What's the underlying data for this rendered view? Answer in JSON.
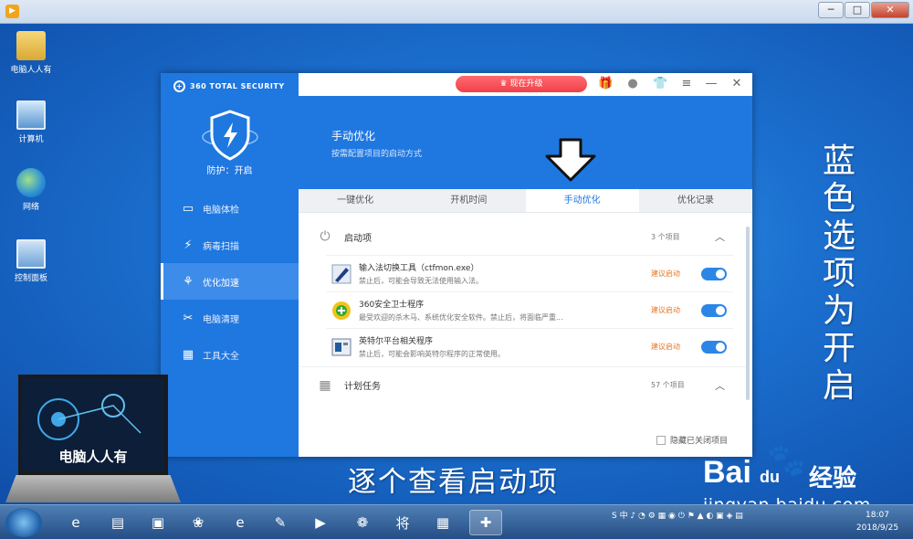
{
  "window": {
    "minimize_glyph": "─",
    "maximize_glyph": "□",
    "close_glyph": "✕"
  },
  "desktop": {
    "icons": [
      {
        "label": "电脑人人有",
        "icon": "folder-icon"
      },
      {
        "label": "计算机",
        "icon": "computer-icon"
      },
      {
        "label": "网络",
        "icon": "network-icon"
      },
      {
        "label": "控制面板",
        "icon": "control-panel-icon"
      }
    ]
  },
  "app": {
    "brand": "360 TOTAL SECURITY",
    "protection_status": "防护：开启",
    "nav": [
      {
        "label": "电脑体检",
        "icon": "monitor-icon",
        "glyph": "▭"
      },
      {
        "label": "病毒扫描",
        "icon": "virus-scan-icon",
        "glyph": "⚡"
      },
      {
        "label": "优化加速",
        "icon": "speedup-icon",
        "glyph": "⚘"
      },
      {
        "label": "电脑清理",
        "icon": "cleanup-icon",
        "glyph": "✂"
      },
      {
        "label": "工具大全",
        "icon": "tools-icon",
        "glyph": "▦"
      }
    ],
    "active_nav_index": 2,
    "topbar": {
      "upgrade_label": "♛ 现在升级",
      "gift_glyph": "🎁",
      "avatar_glyph": "●",
      "shirt_glyph": "👕",
      "menu_glyph": "≡",
      "min_glyph": "—",
      "close_glyph": "✕"
    },
    "hero": {
      "title": "手动优化",
      "subtitle": "按需配置项目的启动方式"
    },
    "tabs": [
      {
        "label": "一键优化"
      },
      {
        "label": "开机时间"
      },
      {
        "label": "手动优化"
      },
      {
        "label": "优化记录"
      }
    ],
    "active_tab_index": 2,
    "startup_section": {
      "title": "启动项",
      "count": "3 个项目",
      "icon": "power-icon"
    },
    "startup_items": [
      {
        "name": "输入法切换工具（ctfmon.exe）",
        "desc": "禁止后，可能会导致无法使用输入法。",
        "hint": "建议启动",
        "enabled": true,
        "icon": "pen-icon"
      },
      {
        "name": "360安全卫士程序",
        "desc": "最受欢迎的杀木马、系统优化安全软件。禁止后，将面临严重...",
        "hint": "建议启动",
        "enabled": true,
        "icon": "360-guard-icon"
      },
      {
        "name": "英特尔平台相关程序",
        "desc": "禁止后，可能会影响英特尔程序的正常使用。",
        "hint": "建议启动",
        "enabled": true,
        "icon": "intel-icon"
      }
    ],
    "scheduled_section": {
      "title": "计划任务",
      "count": "57 个项目",
      "icon": "calendar-icon"
    },
    "hide_closed_label": "隐藏已关闭项目"
  },
  "captions": {
    "side": [
      "蓝",
      "色",
      "选",
      "项",
      "为",
      "开",
      "启"
    ],
    "bottom": "逐个查看启动项"
  },
  "overlay": {
    "laptop_text": "电脑人人有",
    "baidu_text": "Bai",
    "baidu_paw": "🐾",
    "baidu_du": "du",
    "baidu_jingyan": "经验",
    "baidu_url": "jingyan.baidu.com"
  },
  "taskbar": {
    "apps": [
      {
        "icon": "ie-icon",
        "glyph": "e"
      },
      {
        "icon": "explorer-icon",
        "glyph": "▤"
      },
      {
        "icon": "folder-icon",
        "glyph": "▣"
      },
      {
        "icon": "app-icon",
        "glyph": "❀"
      },
      {
        "icon": "browser-icon",
        "glyph": "e"
      },
      {
        "icon": "paint-icon",
        "glyph": "✎"
      },
      {
        "icon": "media-icon",
        "glyph": "▶"
      },
      {
        "icon": "app2-icon",
        "glyph": "❁"
      },
      {
        "icon": "chess-icon",
        "glyph": "将"
      },
      {
        "icon": "video-icon",
        "glyph": "▦"
      },
      {
        "icon": "360-icon",
        "glyph": "✚"
      }
    ],
    "tray_text": "S 中 ♪ ◔ ⚙ ▦ ◉ ⏻ ⚑ ▲ ◐ ▣ ◈ ▤",
    "time": "18:07",
    "date": "2018/9/25"
  },
  "colors": {
    "brand_blue": "#1f77e0",
    "hint_orange": "#e8741e",
    "upgrade_red": "#f0404a"
  }
}
